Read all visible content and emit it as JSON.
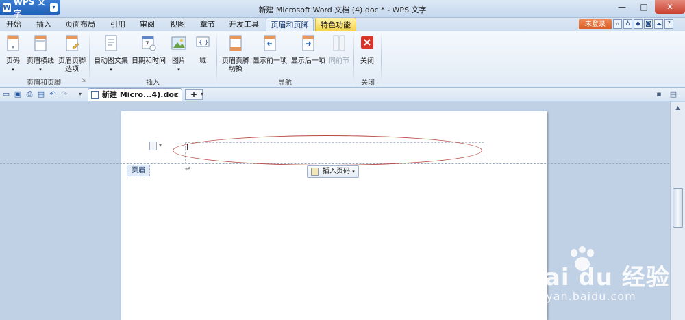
{
  "app": {
    "name": "WPS 文字",
    "window_title": "新建 Microsoft Word 文档 (4).doc * - WPS 文字"
  },
  "window_controls": {
    "minimize": "—",
    "maximize": "□",
    "close": "✕"
  },
  "tabs": [
    {
      "label": "开始"
    },
    {
      "label": "插入"
    },
    {
      "label": "页面布局"
    },
    {
      "label": "引用"
    },
    {
      "label": "审阅"
    },
    {
      "label": "视图"
    },
    {
      "label": "章节"
    },
    {
      "label": "开发工具"
    },
    {
      "label": "页眉和页脚"
    },
    {
      "label": "特色功能"
    }
  ],
  "topright": {
    "login_label": "未登录"
  },
  "ribbon": {
    "page_number": "页码",
    "header_line": "页眉横线",
    "header_footer_options_1": "页眉页脚",
    "header_footer_options_2": "选项",
    "group_header_footer": "页眉和页脚",
    "auto_text": "自动图文集",
    "date_time": "日期和时间",
    "picture": "图片",
    "field": "域",
    "group_insert": "插入",
    "switch_1": "页眉页脚",
    "switch_2": "切换",
    "show_prev": "显示前一项",
    "show_next": "显示后一项",
    "same_as_prev": "同前节",
    "group_nav": "导航",
    "close": "关闭",
    "group_close": "关闭"
  },
  "doc_tab": {
    "label": "新建 Micro...4).doc *",
    "close": "×",
    "new_tab": "+"
  },
  "document": {
    "header_tag": "页眉",
    "insert_page_number": "插入页码",
    "cursor": "I",
    "paragraph_mark": "↵"
  },
  "watermark": {
    "main": "Bai du 经验",
    "sub": "jingyan.baidu.com"
  },
  "colors": {
    "accent": "#1f5fb8",
    "annotation_oval": "#b5493e",
    "login": "#d95b24"
  }
}
